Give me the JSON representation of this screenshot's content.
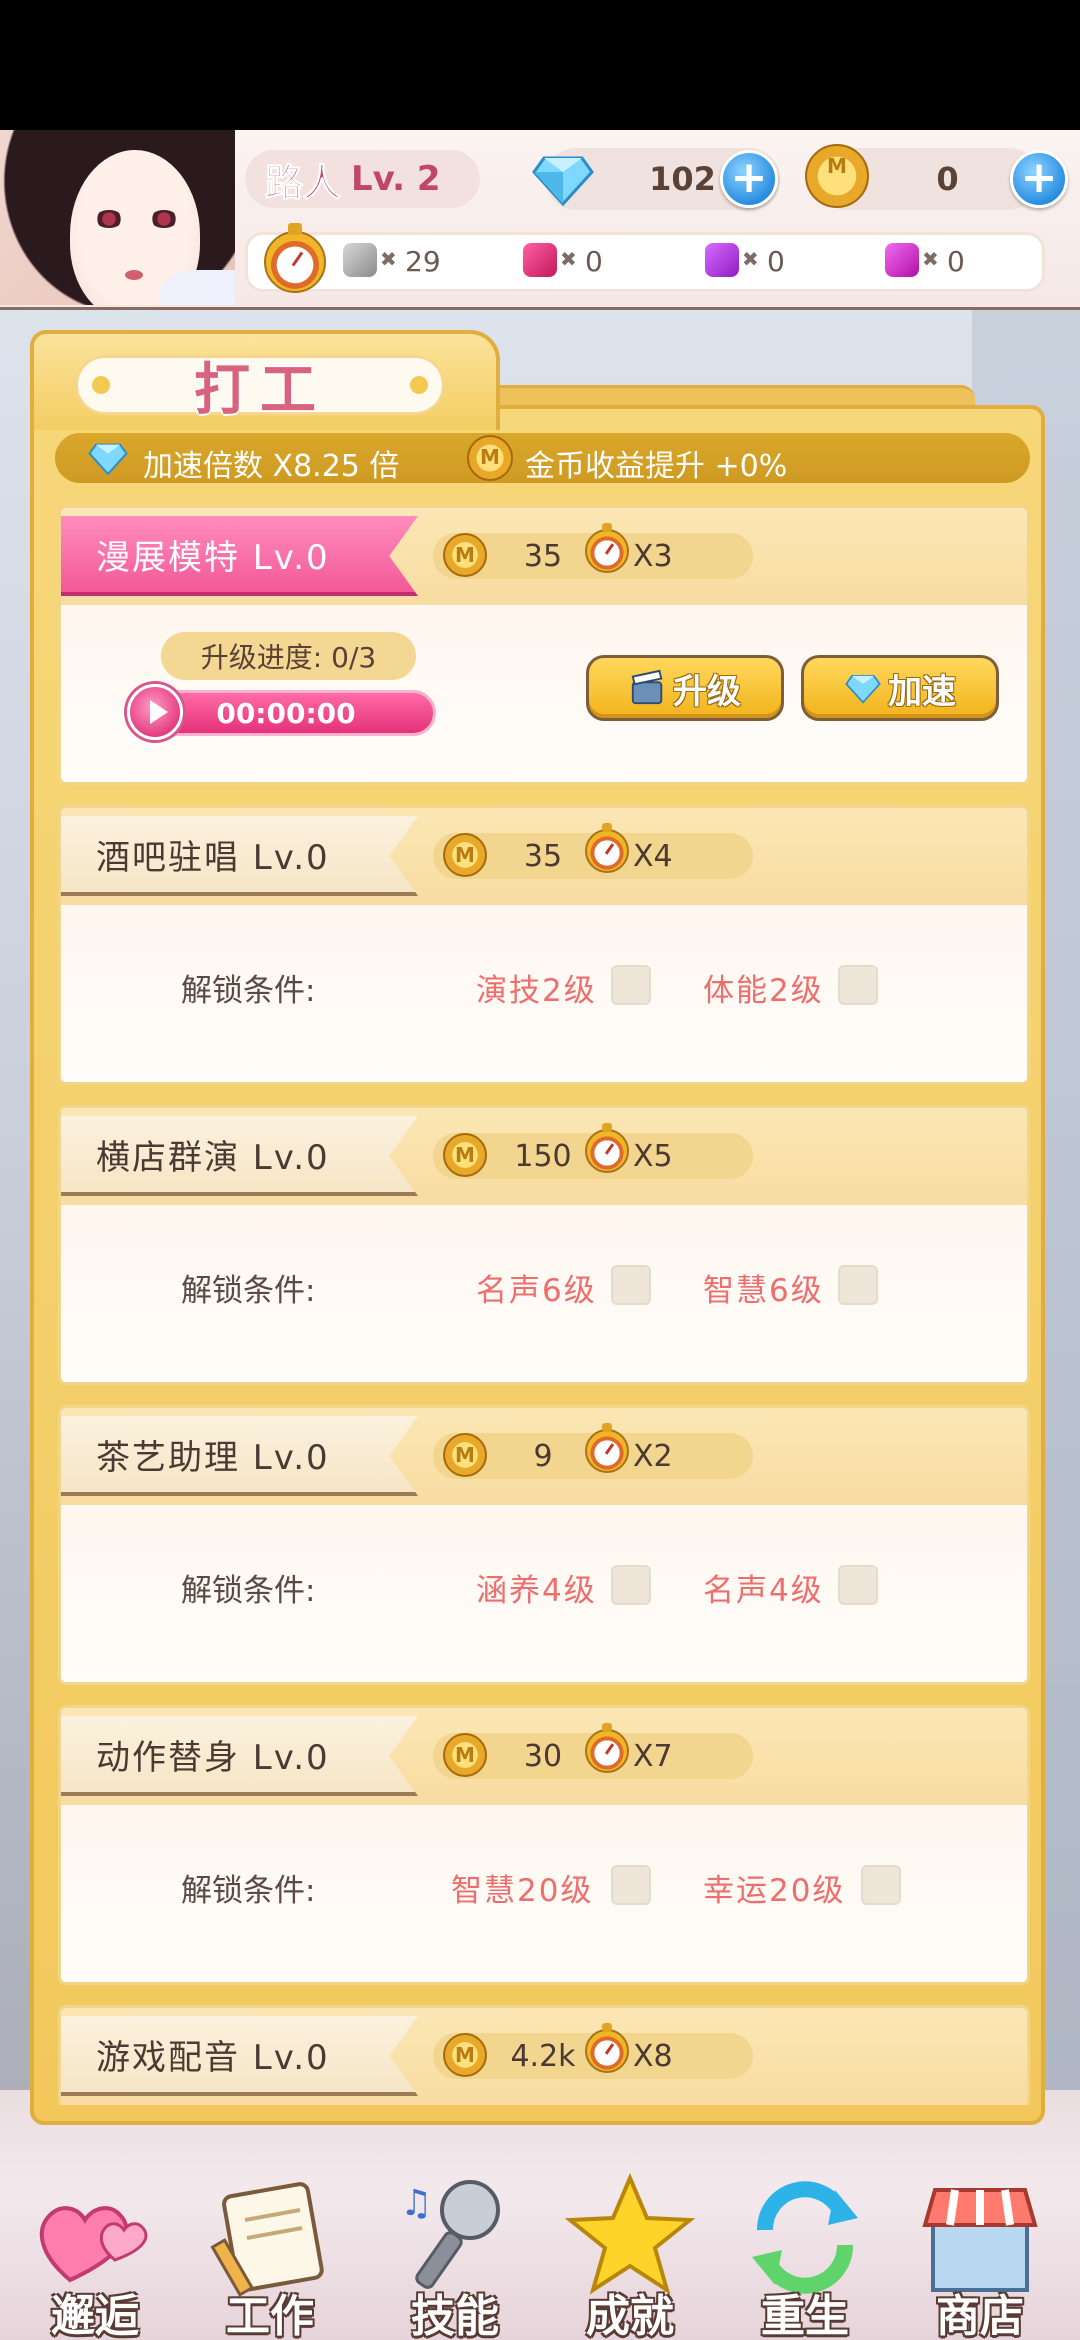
{
  "player": {
    "name": "路人",
    "level": "Lv. 2"
  },
  "currency": {
    "diamonds": "102",
    "coins": "0",
    "add_icon": "plus-icon"
  },
  "stats": {
    "time_items_icon": "stopwatch-icon",
    "items": [
      {
        "icon": "grey-gem-icon",
        "value": "29"
      },
      {
        "icon": "pink-gem-icon",
        "value": "0"
      },
      {
        "icon": "purple-gem-icon",
        "value": "0"
      },
      {
        "icon": "magenta-gem-icon",
        "value": "0"
      }
    ]
  },
  "panel": {
    "title": "打工",
    "speed_multiplier": "加速倍数 X8.25 倍",
    "coin_bonus": "金币收益提升 +0%"
  },
  "jobs": [
    {
      "name": "漫展模特 Lv.0",
      "cost": "35",
      "multiplier": "X3",
      "active": true,
      "progress_label": "升级进度: 0/3",
      "timer": "00:00:00",
      "upgrade_label": "升级",
      "speedup_label": "加速"
    },
    {
      "name": "酒吧驻唱 Lv.0",
      "cost": "35",
      "multiplier": "X4",
      "unlock_label": "解锁条件:",
      "conditions": [
        "演技2级",
        "体能2级"
      ]
    },
    {
      "name": "横店群演 Lv.0",
      "cost": "150",
      "multiplier": "X5",
      "unlock_label": "解锁条件:",
      "conditions": [
        "名声6级",
        "智慧6级"
      ]
    },
    {
      "name": "茶艺助理 Lv.0",
      "cost": "9",
      "multiplier": "X2",
      "unlock_label": "解锁条件:",
      "conditions": [
        "涵养4级",
        "名声4级"
      ]
    },
    {
      "name": "动作替身 Lv.0",
      "cost": "30",
      "multiplier": "X7",
      "unlock_label": "解锁条件:",
      "conditions": [
        "智慧20级",
        "幸运20级"
      ]
    },
    {
      "name": "游戏配音 Lv.0",
      "cost": "4.2k",
      "multiplier": "X8"
    }
  ],
  "nav": [
    {
      "label": "邂逅",
      "icon": "hearts-icon"
    },
    {
      "label": "工作",
      "icon": "notebook-icon"
    },
    {
      "label": "技能",
      "icon": "microphone-icon"
    },
    {
      "label": "成就",
      "icon": "star-icon"
    },
    {
      "label": "重生",
      "icon": "refresh-icon"
    },
    {
      "label": "商店",
      "icon": "shop-icon"
    }
  ],
  "colors": {
    "accent_pink": "#f35899",
    "panel_gold": "#f2c85b",
    "condition_red": "#ee6d6d"
  }
}
